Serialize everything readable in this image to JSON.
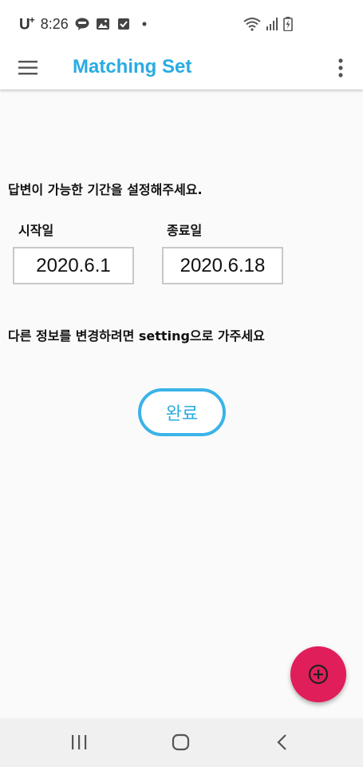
{
  "status_bar": {
    "carrier": "U",
    "carrier_plus": "+",
    "time": "8:26",
    "icons": [
      "talk-icon",
      "image-icon",
      "check-icon",
      "dot-icon",
      "wifi-icon",
      "signal-icon",
      "battery-icon"
    ]
  },
  "app_bar": {
    "title": "Matching Set",
    "menu_icon": "hamburger-menu-icon",
    "overflow_icon": "more-vert-icon"
  },
  "form": {
    "instruction": "답변이 가능한 기간을 설정해주세요.",
    "start_label": "시작일",
    "end_label": "종료일",
    "start_value": "2020.6.1",
    "end_value": "2020.6.18",
    "note": "다른 정보를 변경하려면 setting으로 가주세요",
    "done_label": "완료"
  },
  "fab": {
    "icon": "add-circle-icon"
  },
  "nav_bar": {
    "icons": [
      "recent-apps-icon",
      "home-icon",
      "back-icon"
    ]
  },
  "colors": {
    "accent": "#29abe2",
    "fab": "#e01e5a",
    "input_border": "#c8c8c8",
    "background": "#fafafa"
  }
}
